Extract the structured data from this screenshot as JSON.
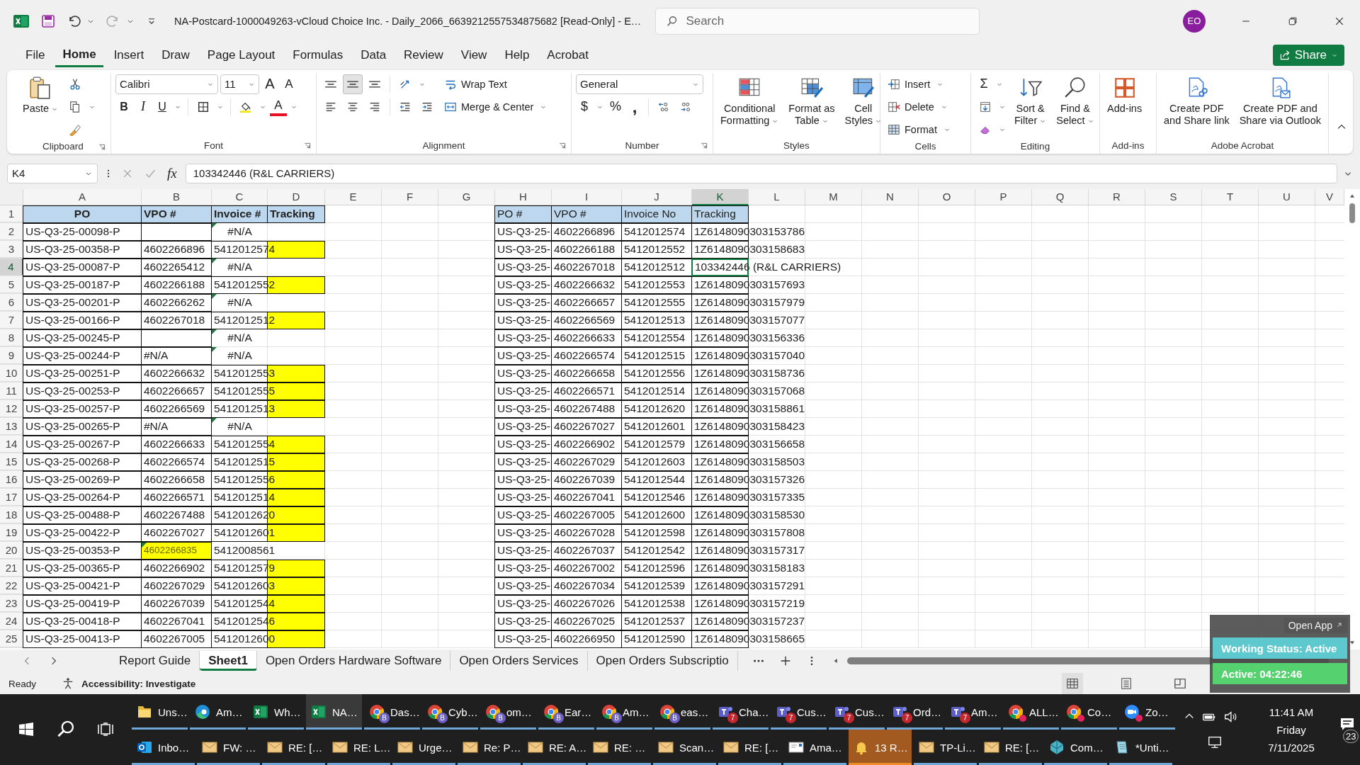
{
  "title_bar": {
    "title": "NA-Postcard-1000049263-vCloud Choice Inc. - Daily_2066_6639212557534875682  [Read-Only]  -  E…",
    "search": {
      "placeholder": "Search"
    },
    "avatar": "EO"
  },
  "menu_tabs": [
    {
      "label": "File",
      "selected": false
    },
    {
      "label": "Home",
      "selected": true
    },
    {
      "label": "Insert",
      "selected": false
    },
    {
      "label": "Draw",
      "selected": false
    },
    {
      "label": "Page Layout",
      "selected": false
    },
    {
      "label": "Formulas",
      "selected": false
    },
    {
      "label": "Data",
      "selected": false
    },
    {
      "label": "Review",
      "selected": false
    },
    {
      "label": "View",
      "selected": false
    },
    {
      "label": "Help",
      "selected": false
    },
    {
      "label": "Acrobat",
      "selected": false
    }
  ],
  "share_button": {
    "label": "Share"
  },
  "ribbon": {
    "groups": [
      {
        "label": "Clipboard",
        "launcher": true,
        "columns": [
          [
            [
              {
                "kind": "large",
                "label": "Paste",
                "menu": true
              }
            ]
          ],
          [
            [
              {
                "kind": "icon"
              }
            ],
            [
              {
                "kind": "icon"
              },
              {
                "kind": "caret"
              }
            ],
            [
              {
                "kind": "icon"
              }
            ]
          ]
        ]
      },
      {
        "label": "Font",
        "launcher": true,
        "columns": [
          [
            [
              {
                "kind": "combo",
                "value": "Calibri"
              },
              {
                "kind": "combo",
                "value": "11"
              },
              {
                "kind": "glyph",
                "text": "A"
              },
              {
                "kind": "glyph",
                "text": "A"
              }
            ],
            [
              {
                "kind": "glyph",
                "text": "B"
              },
              {
                "kind": "glyph",
                "text": "I"
              },
              {
                "kind": "glyph",
                "text": "U"
              },
              {
                "kind": "caret"
              },
              {
                "kind": "sep"
              },
              {
                "kind": "icon"
              },
              {
                "kind": "caret"
              },
              {
                "kind": "sep"
              },
              {
                "kind": "icon"
              },
              {
                "kind": "caret"
              },
              {
                "kind": "glyph",
                "text": "A"
              },
              {
                "kind": "caret"
              }
            ]
          ]
        ]
      },
      {
        "label": "Alignment",
        "launcher": true,
        "columns": [
          [
            [
              {
                "kind": "icon",
                "pressed": false
              },
              {
                "kind": "icon",
                "pressed": true
              },
              {
                "kind": "icon",
                "pressed": false
              },
              {
                "kind": "sep"
              },
              {
                "kind": "icon"
              },
              {
                "kind": "caret"
              }
            ],
            [
              {
                "kind": "icon"
              },
              {
                "kind": "icon"
              },
              {
                "kind": "icon"
              },
              {
                "kind": "sep"
              },
              {
                "kind": "icon"
              },
              {
                "kind": "icon"
              }
            ]
          ],
          [
            [
              {
                "kind": "small",
                "label": "Wrap Text",
                "menu": false
              }
            ],
            [
              {
                "kind": "small",
                "label": "Merge & Center",
                "menu": true
              }
            ]
          ]
        ]
      },
      {
        "label": "Number",
        "launcher": true,
        "columns": [
          [
            [
              {
                "kind": "combo",
                "value": "General"
              }
            ],
            [
              {
                "kind": "glyph",
                "text": "$"
              },
              {
                "kind": "caret"
              },
              {
                "kind": "glyph",
                "text": "%"
              },
              {
                "kind": "glyph",
                "text": ","
              },
              {
                "kind": "sep"
              },
              {
                "kind": "icon"
              },
              {
                "kind": "icon"
              }
            ]
          ]
        ]
      },
      {
        "label": "Styles",
        "launcher": false,
        "columns": [
          [
            [
              {
                "kind": "large",
                "label": "Conditional\nFormatting",
                "menu": true
              }
            ]
          ],
          [
            [
              {
                "kind": "large",
                "label": "Format as\nTable",
                "menu": true
              }
            ]
          ],
          [
            [
              {
                "kind": "large",
                "label": "Cell\nStyles",
                "menu": true
              }
            ]
          ]
        ]
      },
      {
        "label": "Cells",
        "launcher": false,
        "columns": [
          [
            [
              {
                "kind": "small",
                "label": "Insert",
                "menu": true
              }
            ],
            [
              {
                "kind": "small",
                "label": "Delete",
                "menu": true
              }
            ],
            [
              {
                "kind": "small",
                "label": "Format",
                "menu": true
              }
            ]
          ]
        ]
      },
      {
        "label": "Editing",
        "launcher": false,
        "columns": [
          [
            [
              {
                "kind": "glyph",
                "text": "Σ"
              },
              {
                "kind": "caret"
              }
            ],
            [
              {
                "kind": "icon"
              },
              {
                "kind": "caret"
              }
            ],
            [
              {
                "kind": "icon"
              },
              {
                "kind": "caret"
              }
            ]
          ],
          [
            [
              {
                "kind": "large",
                "label": "Sort &\nFilter",
                "menu": true
              }
            ]
          ],
          [
            [
              {
                "kind": "large",
                "label": "Find &\nSelect",
                "menu": true
              }
            ]
          ]
        ]
      },
      {
        "label": "Add-ins",
        "launcher": false,
        "columns": [
          [
            [
              {
                "kind": "large",
                "label": "Add-ins",
                "menu": false
              }
            ]
          ]
        ]
      },
      {
        "label": "Adobe Acrobat",
        "launcher": false,
        "columns": [
          [
            [
              {
                "kind": "large",
                "label": "Create PDF\nand Share link",
                "menu": false
              }
            ]
          ],
          [
            [
              {
                "kind": "large",
                "label": "Create PDF and\nShare via Outlook",
                "menu": false
              }
            ]
          ]
        ]
      }
    ]
  },
  "formula_bar": {
    "name_box": "K4",
    "fx": "fx",
    "formula": "103342446 (R&L CARRIERS)"
  },
  "sheet": {
    "column_headers": [
      {
        "label": "A",
        "selected": false
      },
      {
        "label": "B",
        "selected": false
      },
      {
        "label": "C",
        "selected": false
      },
      {
        "label": "D",
        "selected": false
      },
      {
        "label": "E",
        "selected": false
      },
      {
        "label": "F",
        "selected": false
      },
      {
        "label": "G",
        "selected": false
      },
      {
        "label": "H",
        "selected": false
      },
      {
        "label": "I",
        "selected": false
      },
      {
        "label": "J",
        "selected": false
      },
      {
        "label": "K",
        "selected": true
      },
      {
        "label": "L",
        "selected": false
      },
      {
        "label": "M",
        "selected": false
      },
      {
        "label": "N",
        "selected": false
      },
      {
        "label": "O",
        "selected": false
      },
      {
        "label": "P",
        "selected": false
      },
      {
        "label": "Q",
        "selected": false
      },
      {
        "label": "R",
        "selected": false
      },
      {
        "label": "S",
        "selected": false
      },
      {
        "label": "T",
        "selected": false
      },
      {
        "label": "U",
        "selected": false
      },
      {
        "label": "V",
        "selected": false
      }
    ],
    "row_headers": [
      {
        "label": "1",
        "selected": false
      },
      {
        "label": "2",
        "selected": false
      },
      {
        "label": "3",
        "selected": false
      },
      {
        "label": "4",
        "selected": true
      },
      {
        "label": "5",
        "selected": false
      },
      {
        "label": "6",
        "selected": false
      },
      {
        "label": "7",
        "selected": false
      },
      {
        "label": "8",
        "selected": false
      },
      {
        "label": "9",
        "selected": false
      },
      {
        "label": "10",
        "selected": false
      },
      {
        "label": "11",
        "selected": false
      },
      {
        "label": "12",
        "selected": false
      },
      {
        "label": "13",
        "selected": false
      },
      {
        "label": "14",
        "selected": false
      },
      {
        "label": "15",
        "selected": false
      },
      {
        "label": "16",
        "selected": false
      },
      {
        "label": "17",
        "selected": false
      },
      {
        "label": "18",
        "selected": false
      },
      {
        "label": "19",
        "selected": false
      },
      {
        "label": "20",
        "selected": false
      },
      {
        "label": "21",
        "selected": false
      },
      {
        "label": "22",
        "selected": false
      },
      {
        "label": "23",
        "selected": false
      },
      {
        "label": "24",
        "selected": false
      },
      {
        "label": "25",
        "selected": false
      }
    ],
    "left_table": {
      "columns": [
        "PO",
        "VPO #",
        "Invoice #",
        "Tracking"
      ],
      "rows": [
        {
          "po": "US-Q3-25-00098-P",
          "invoice": "#N/A",
          "vpo_flag": false,
          "invoice_flag": true,
          "vpo_highlight": false,
          "tracking_highlight": false
        },
        {
          "po": "US-Q3-25-00358-P",
          "vpo": "4602266896",
          "invoice": "5412012574",
          "vpo_flag": false,
          "invoice_flag": false,
          "vpo_highlight": false,
          "tracking_highlight": true
        },
        {
          "po": "US-Q3-25-00087-P",
          "vpo": "4602265412",
          "invoice": "#N/A",
          "vpo_flag": false,
          "invoice_flag": true,
          "vpo_highlight": false,
          "tracking_highlight": false
        },
        {
          "po": "US-Q3-25-00187-P",
          "vpo": "4602266188",
          "invoice": "5412012552",
          "vpo_flag": false,
          "invoice_flag": false,
          "vpo_highlight": false,
          "tracking_highlight": true
        },
        {
          "po": "US-Q3-25-00201-P",
          "vpo": "4602266262",
          "invoice": "#N/A",
          "vpo_flag": false,
          "invoice_flag": true,
          "vpo_highlight": false,
          "tracking_highlight": false
        },
        {
          "po": "US-Q3-25-00166-P",
          "vpo": "4602267018",
          "invoice": "5412012512",
          "vpo_flag": false,
          "invoice_flag": false,
          "vpo_highlight": false,
          "tracking_highlight": true
        },
        {
          "po": "US-Q3-25-00245-P",
          "invoice": "#N/A",
          "vpo_flag": false,
          "invoice_flag": true,
          "vpo_highlight": false,
          "tracking_highlight": false
        },
        {
          "po": "US-Q3-25-00244-P",
          "vpo": "#N/A",
          "invoice": "#N/A",
          "vpo_flag": false,
          "invoice_flag": true,
          "vpo_highlight": false,
          "tracking_highlight": false
        },
        {
          "po": "US-Q3-25-00251-P",
          "vpo": "4602266632",
          "invoice": "5412012553",
          "vpo_flag": false,
          "invoice_flag": false,
          "vpo_highlight": false,
          "tracking_highlight": true
        },
        {
          "po": "US-Q3-25-00253-P",
          "vpo": "4602266657",
          "invoice": "5412012555",
          "vpo_flag": false,
          "invoice_flag": false,
          "vpo_highlight": false,
          "tracking_highlight": true
        },
        {
          "po": "US-Q3-25-00257-P",
          "vpo": "4602266569",
          "invoice": "5412012513",
          "vpo_flag": false,
          "invoice_flag": false,
          "vpo_highlight": false,
          "tracking_highlight": true
        },
        {
          "po": "US-Q3-25-00265-P",
          "vpo": "#N/A",
          "invoice": "#N/A",
          "vpo_flag": false,
          "invoice_flag": true,
          "vpo_highlight": false,
          "tracking_highlight": false
        },
        {
          "po": "US-Q3-25-00267-P",
          "vpo": "4602266633",
          "invoice": "5412012554",
          "vpo_flag": false,
          "invoice_flag": false,
          "vpo_highlight": false,
          "tracking_highlight": true
        },
        {
          "po": "US-Q3-25-00268-P",
          "vpo": "4602266574",
          "invoice": "5412012515",
          "vpo_flag": false,
          "invoice_flag": false,
          "vpo_highlight": false,
          "tracking_highlight": true
        },
        {
          "po": "US-Q3-25-00269-P",
          "vpo": "4602266658",
          "invoice": "5412012556",
          "vpo_flag": false,
          "invoice_flag": false,
          "vpo_highlight": false,
          "tracking_highlight": true
        },
        {
          "po": "US-Q3-25-00264-P",
          "vpo": "4602266571",
          "invoice": "5412012514",
          "vpo_flag": false,
          "invoice_flag": false,
          "vpo_highlight": false,
          "tracking_highlight": true
        },
        {
          "po": "US-Q3-25-00488-P",
          "vpo": "4602267488",
          "invoice": "5412012620",
          "vpo_flag": false,
          "invoice_flag": false,
          "vpo_highlight": false,
          "tracking_highlight": true
        },
        {
          "po": "US-Q3-25-00422-P",
          "vpo": "4602267027",
          "invoice": "5412012601",
          "vpo_flag": false,
          "invoice_flag": false,
          "vpo_highlight": false,
          "tracking_highlight": true
        },
        {
          "po": "US-Q3-25-00353-P",
          "vpo": "4602266835",
          "invoice": "5412008561",
          "vpo_flag": true,
          "invoice_flag": false,
          "vpo_highlight": true,
          "tracking_highlight": false
        },
        {
          "po": "US-Q3-25-00365-P",
          "vpo": "4602266902",
          "invoice": "5412012579",
          "vpo_flag": false,
          "invoice_flag": false,
          "vpo_highlight": false,
          "tracking_highlight": true
        },
        {
          "po": "US-Q3-25-00421-P",
          "vpo": "4602267029",
          "invoice": "5412012603",
          "vpo_flag": false,
          "invoice_flag": false,
          "vpo_highlight": false,
          "tracking_highlight": true
        },
        {
          "po": "US-Q3-25-00419-P",
          "vpo": "4602267039",
          "invoice": "5412012544",
          "vpo_flag": false,
          "invoice_flag": false,
          "vpo_highlight": false,
          "tracking_highlight": true
        },
        {
          "po": "US-Q3-25-00418-P",
          "vpo": "4602267041",
          "invoice": "5412012546",
          "vpo_flag": false,
          "invoice_flag": false,
          "vpo_highlight": false,
          "tracking_highlight": true
        },
        {
          "po": "US-Q3-25-00413-P",
          "vpo": "4602267005",
          "invoice": "5412012600",
          "vpo_flag": false,
          "invoice_flag": false,
          "vpo_highlight": false,
          "tracking_highlight": true
        }
      ]
    },
    "right_table": {
      "columns": [
        "PO #",
        "VPO #",
        "Invoice No",
        "Tracking"
      ],
      "rows": [
        {
          "po": "US-Q3-25-",
          "vpo": "4602266896",
          "invoice": "5412012574",
          "tracking": "1Z6148090303153786",
          "selected": false
        },
        {
          "po": "US-Q3-25-",
          "vpo": "4602266188",
          "invoice": "5412012552",
          "tracking": "1Z6148090303158683",
          "selected": false
        },
        {
          "po": "US-Q3-25-",
          "vpo": "4602267018",
          "invoice": "5412012512",
          "tracking": "103342446 (R&L CARRIERS)",
          "selected": true
        },
        {
          "po": "US-Q3-25-",
          "vpo": "4602266632",
          "invoice": "5412012553",
          "tracking": "1Z6148090303157693",
          "selected": false
        },
        {
          "po": "US-Q3-25-",
          "vpo": "4602266657",
          "invoice": "5412012555",
          "tracking": "1Z6148090303157979",
          "selected": false
        },
        {
          "po": "US-Q3-25-",
          "vpo": "4602266569",
          "invoice": "5412012513",
          "tracking": "1Z6148090303157077",
          "selected": false
        },
        {
          "po": "US-Q3-25-",
          "vpo": "4602266633",
          "invoice": "5412012554",
          "tracking": "1Z6148090303156336",
          "selected": false
        },
        {
          "po": "US-Q3-25-",
          "vpo": "4602266574",
          "invoice": "5412012515",
          "tracking": "1Z6148090303157040",
          "selected": false
        },
        {
          "po": "US-Q3-25-",
          "vpo": "4602266658",
          "invoice": "5412012556",
          "tracking": "1Z6148090303158736",
          "selected": false
        },
        {
          "po": "US-Q3-25-",
          "vpo": "4602266571",
          "invoice": "5412012514",
          "tracking": "1Z6148090303157068",
          "selected": false
        },
        {
          "po": "US-Q3-25-",
          "vpo": "4602267488",
          "invoice": "5412012620",
          "tracking": "1Z6148090303158861",
          "selected": false
        },
        {
          "po": "US-Q3-25-",
          "vpo": "4602267027",
          "invoice": "5412012601",
          "tracking": "1Z6148090303158423",
          "selected": false
        },
        {
          "po": "US-Q3-25-",
          "vpo": "4602266902",
          "invoice": "5412012579",
          "tracking": "1Z6148090303156658",
          "selected": false
        },
        {
          "po": "US-Q3-25-",
          "vpo": "4602267029",
          "invoice": "5412012603",
          "tracking": "1Z6148090303158503",
          "selected": false
        },
        {
          "po": "US-Q3-25-",
          "vpo": "4602267039",
          "invoice": "5412012544",
          "tracking": "1Z6148090303157326",
          "selected": false
        },
        {
          "po": "US-Q3-25-",
          "vpo": "4602267041",
          "invoice": "5412012546",
          "tracking": "1Z6148090303157335",
          "selected": false
        },
        {
          "po": "US-Q3-25-",
          "vpo": "4602267005",
          "invoice": "5412012600",
          "tracking": "1Z6148090303158530",
          "selected": false
        },
        {
          "po": "US-Q3-25-",
          "vpo": "4602267028",
          "invoice": "5412012598",
          "tracking": "1Z6148090303157808",
          "selected": false
        },
        {
          "po": "US-Q3-25-",
          "vpo": "4602267037",
          "invoice": "5412012542",
          "tracking": "1Z6148090303157317",
          "selected": false
        },
        {
          "po": "US-Q3-25-",
          "vpo": "4602267002",
          "invoice": "5412012596",
          "tracking": "1Z6148090303158183",
          "selected": false
        },
        {
          "po": "US-Q3-25-",
          "vpo": "4602267034",
          "invoice": "5412012539",
          "tracking": "1Z6148090303157291",
          "selected": false
        },
        {
          "po": "US-Q3-25-",
          "vpo": "4602267026",
          "invoice": "5412012538",
          "tracking": "1Z6148090303157219",
          "selected": false
        },
        {
          "po": "US-Q3-25-",
          "vpo": "4602267025",
          "invoice": "5412012537",
          "tracking": "1Z6148090303157237",
          "selected": false
        },
        {
          "po": "US-Q3-25-",
          "vpo": "4602266950",
          "invoice": "5412012590",
          "tracking": "1Z6148090303158665",
          "selected": false
        }
      ]
    }
  },
  "sheet_tabs": [
    {
      "label": "Report Guide",
      "selected": false
    },
    {
      "label": "Sheet1",
      "selected": true
    },
    {
      "label": "Open Orders Hardware Software",
      "selected": false
    },
    {
      "label": "Open Orders Services",
      "selected": false
    },
    {
      "label": "Open Orders Subscriptio",
      "selected": false
    }
  ],
  "status_bar": {
    "mode": "Ready",
    "accessibility": "Accessibility: Investigate"
  },
  "status_widget": {
    "open_app": "Open App",
    "status": "Working Status: Active",
    "timer": "Active: 04:22:46"
  },
  "taskbar": {
    "row_1": [
      {
        "label": "Uns…",
        "kind": "folder",
        "active": false,
        "flashing": false,
        "alert": false
      },
      {
        "label": "Am…",
        "kind": "edge",
        "active": false,
        "flashing": false,
        "alert": false
      },
      {
        "label": "Wh…",
        "kind": "sheet",
        "active": false,
        "flashing": false,
        "alert": false
      },
      {
        "label": "NA…",
        "kind": "sheet",
        "active": true,
        "flashing": false,
        "alert": false
      },
      {
        "label": "Das…",
        "kind": "chrome",
        "badge": "B",
        "active": false,
        "flashing": false,
        "alert": false
      },
      {
        "label": "Cyb…",
        "kind": "chrome",
        "badge": "B",
        "active": false,
        "flashing": false,
        "alert": false
      },
      {
        "label": "om…",
        "kind": "chrome",
        "badge": "B",
        "active": false,
        "flashing": false,
        "alert": false
      },
      {
        "label": "Ear…",
        "kind": "chrome",
        "badge": "B",
        "active": false,
        "flashing": false,
        "alert": false
      },
      {
        "label": "Am…",
        "kind": "chrome",
        "badge": "B",
        "active": false,
        "flashing": false,
        "alert": false
      },
      {
        "label": "eas…",
        "kind": "chrome",
        "badge": "B",
        "active": false,
        "flashing": false,
        "alert": false
      },
      {
        "label": "Cha…",
        "kind": "teams",
        "badge": "7",
        "active": false,
        "flashing": false,
        "alert": false
      },
      {
        "label": "Cus…",
        "kind": "teams",
        "badge": "7",
        "active": false,
        "flashing": false,
        "alert": false
      },
      {
        "label": "Cus…",
        "kind": "teams",
        "badge": "7",
        "active": false,
        "flashing": false,
        "alert": false
      },
      {
        "label": "Ord…",
        "kind": "teams",
        "badge": "7",
        "active": false,
        "flashing": false,
        "alert": false
      },
      {
        "label": "Am…",
        "kind": "teams",
        "badge": "7",
        "active": false,
        "flashing": false,
        "alert": false
      },
      {
        "label": "ALL…",
        "kind": "chrome",
        "active": false,
        "flashing": false,
        "alert": true
      },
      {
        "label": "Co…",
        "kind": "chrome",
        "active": false,
        "flashing": false,
        "alert": true
      },
      {
        "label": "Zo…",
        "kind": "zoom",
        "active": false,
        "flashing": false,
        "alert": true
      }
    ],
    "row_2": [
      {
        "label": "Inbo…",
        "kind": "outlook",
        "active": false,
        "flashing": false
      },
      {
        "label": "FW: …",
        "kind": "mail",
        "active": false,
        "flashing": false
      },
      {
        "label": "RE: […",
        "kind": "mail",
        "active": false,
        "flashing": false
      },
      {
        "label": "RE: L…",
        "kind": "mail",
        "active": false,
        "flashing": false
      },
      {
        "label": "Urge…",
        "kind": "mail",
        "active": false,
        "flashing": false
      },
      {
        "label": "Re: P…",
        "kind": "mail",
        "active": false,
        "flashing": false
      },
      {
        "label": "RE: A…",
        "kind": "mail",
        "active": false,
        "flashing": false
      },
      {
        "label": "RE: …",
        "kind": "mail",
        "active": false,
        "flashing": false
      },
      {
        "label": "Scan…",
        "kind": "mail",
        "active": false,
        "flashing": false
      },
      {
        "label": "RE: […",
        "kind": "mail",
        "active": false,
        "flashing": false
      },
      {
        "label": "Ama…",
        "kind": "letter",
        "active": false,
        "flashing": false
      },
      {
        "label": "13 R…",
        "kind": "bell",
        "active": false,
        "flashing": true
      },
      {
        "label": "TP-Li…",
        "kind": "mail",
        "active": false,
        "flashing": false
      },
      {
        "label": "RE: […",
        "kind": "mail",
        "active": false,
        "flashing": false
      },
      {
        "label": "Com…",
        "kind": "cube",
        "active": false,
        "flashing": false
      },
      {
        "label": "*Unti…",
        "kind": "notepad",
        "active": false,
        "flashing": false
      }
    ],
    "tray": {
      "time": "11:41 AM",
      "day": "Friday",
      "date": "7/11/2025",
      "notifications": "23"
    }
  }
}
